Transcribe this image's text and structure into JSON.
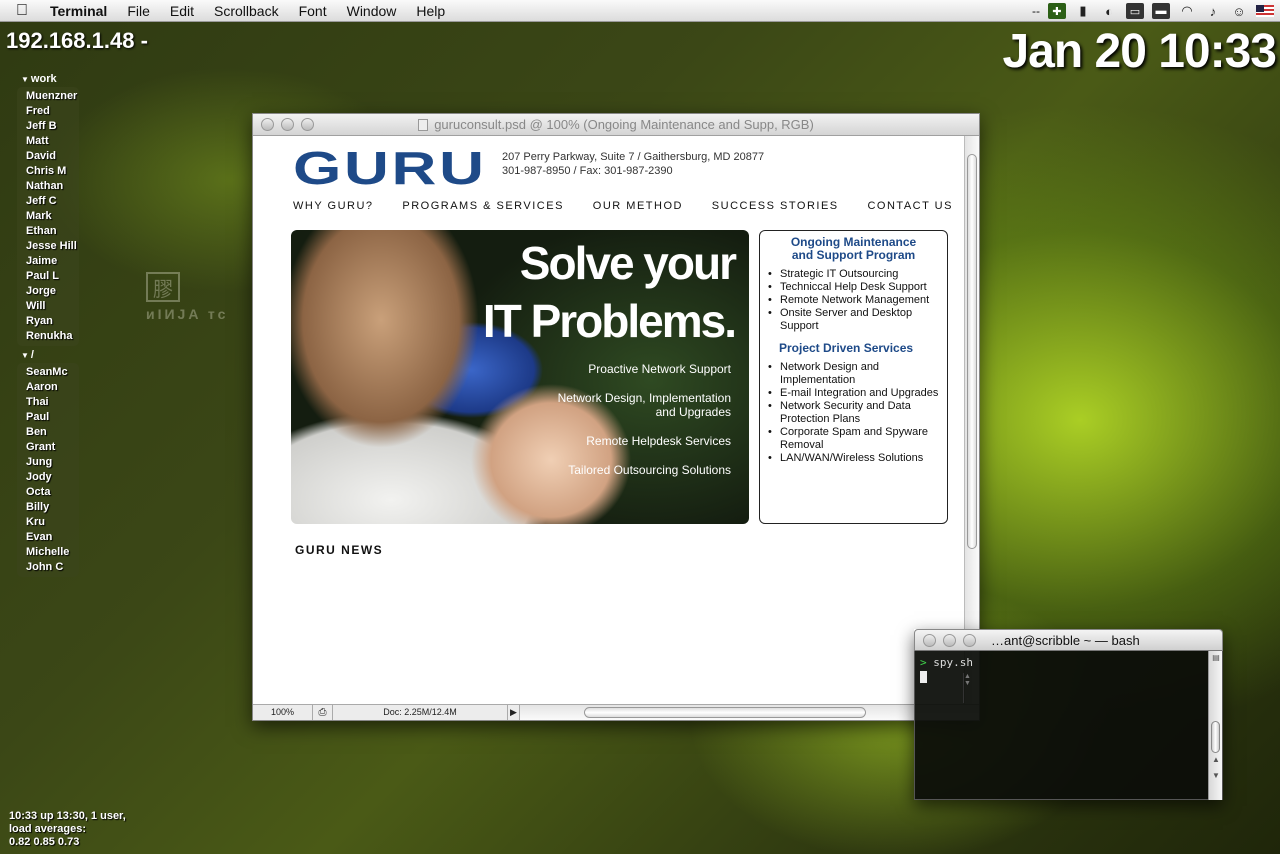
{
  "menubar": {
    "app": "Terminal",
    "items": [
      "File",
      "Edit",
      "Scrollback",
      "Font",
      "Window",
      "Help"
    ],
    "tray_dash": "--"
  },
  "desktop": {
    "ip": "192.168.1.48 -",
    "clock": "Jan 20 10:33",
    "uptime_line1": "10:33  up 13:30, 1 user,",
    "uptime_line2": "load averages:",
    "uptime_line3": "0.82 0.85 0.73"
  },
  "buddy_list": {
    "groups": [
      {
        "name": "work",
        "members": [
          "Muenzner",
          "Fred",
          "Jeff B",
          "Matt",
          "David",
          "Chris M",
          "Nathan",
          "Jeff C",
          "Mark",
          "Ethan",
          "Jesse Hill",
          "Jaime",
          "Paul L",
          "Jorge",
          "Will",
          "Ryan",
          "Renukha"
        ]
      },
      {
        "name": "/",
        "members": [
          "SeanMc",
          "Aaron",
          "Thai",
          "Paul",
          "Ben",
          "Grant",
          "Jung",
          "Jody",
          "Octa",
          "Billy",
          "Kru",
          "Evan",
          "Michelle",
          "John C"
        ]
      }
    ]
  },
  "photoshop": {
    "title": "guruconsult.psd @ 100% (Ongoing Maintenance   and Supp, RGB)",
    "zoom": "100%",
    "doc_info": "Doc: 2.25M/12.4M"
  },
  "site": {
    "logo": "GURU",
    "address_line1": "207 Perry Parkway, Suite 7 / Gaithersburg, MD 20877",
    "address_line2": "301-987-8950 / Fax: 301-987-2390",
    "nav": [
      "WHY GURU?",
      "PROGRAMS & SERVICES",
      "OUR METHOD",
      "SUCCESS STORIES",
      "CONTACT US"
    ],
    "hero_line1": "Solve your",
    "hero_line2": "IT Problems.",
    "hero_services": [
      "Proactive Network Support",
      "Network Design, Implementation\nand Upgrades",
      "Remote Helpdesk Services",
      "Tailored Outsourcing Solutions"
    ],
    "box_title1": "Ongoing Maintenance\nand Support Program",
    "box_list1": [
      "Strategic IT Outsourcing",
      "Techniccal Help Desk Support",
      "Remote Network Management",
      "Onsite Server and Desktop Support"
    ],
    "box_title2": "Project Driven Services",
    "box_list2": [
      "Network Design and Implementation",
      "E-mail Integration and Upgrades",
      "Network Security and Data Protection Plans",
      "Corporate Spam and Spyware Removal",
      "LAN/WAN/Wireless Solutions"
    ],
    "news_heading": "GURU NEWS"
  },
  "terminal": {
    "title": "…ant@scribble ~ — bash",
    "prompt": ">",
    "command": "spy.sh"
  },
  "colors": {
    "brand_blue": "#1e4a88",
    "prompt_green": "#3fd24a"
  }
}
